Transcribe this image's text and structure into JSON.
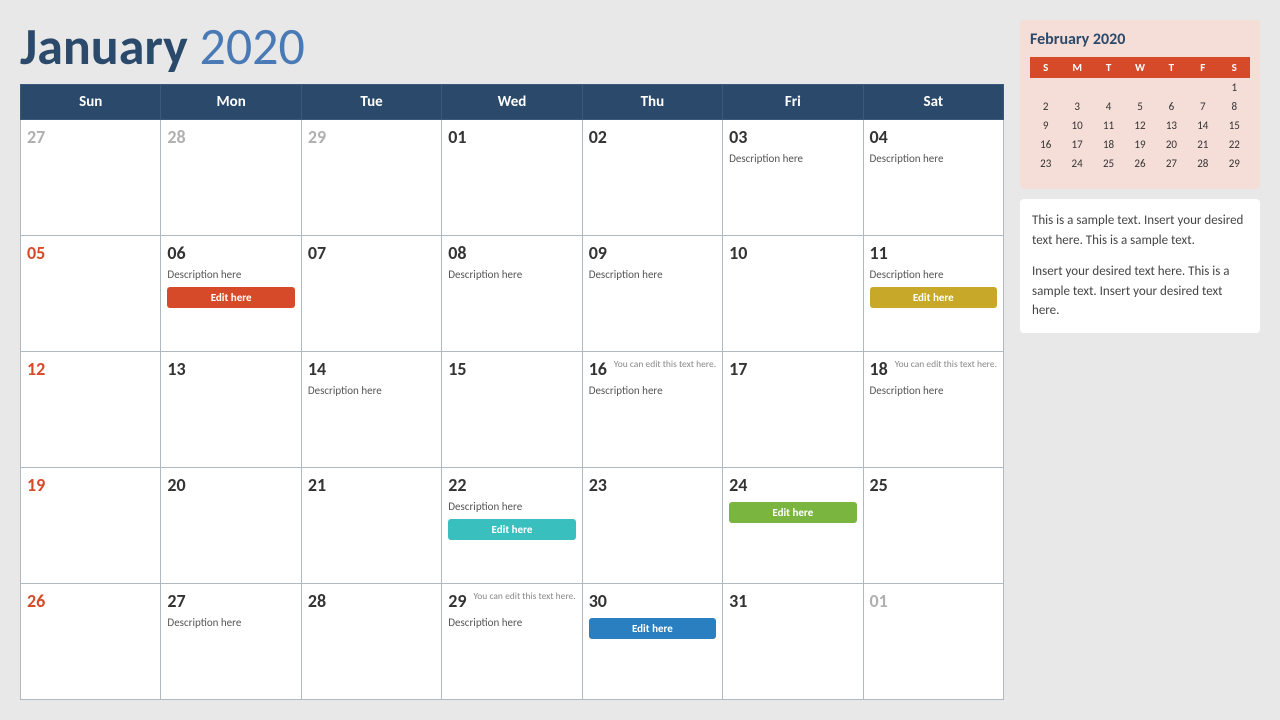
{
  "header": {
    "title_bold": "January",
    "title_light": " 2020"
  },
  "weekdays": [
    "Sun",
    "Mon",
    "Tue",
    "Wed",
    "Thu",
    "Fri",
    "Sat"
  ],
  "weeks": [
    [
      {
        "day": "27",
        "type": "grayed"
      },
      {
        "day": "28",
        "type": "grayed"
      },
      {
        "day": "29",
        "type": "grayed"
      },
      {
        "day": "01",
        "desc": ""
      },
      {
        "day": "02",
        "desc": ""
      },
      {
        "day": "03",
        "desc": "Description here"
      },
      {
        "day": "04",
        "desc": "Description here"
      }
    ],
    [
      {
        "day": "05",
        "type": "sunday"
      },
      {
        "day": "06",
        "desc": "Description here",
        "btn": "Edit here",
        "btnClass": "btn-orange"
      },
      {
        "day": "07",
        "desc": ""
      },
      {
        "day": "08",
        "desc": "Description here"
      },
      {
        "day": "09",
        "desc": "Description here"
      },
      {
        "day": "10",
        "desc": ""
      },
      {
        "day": "11",
        "desc": "Description here",
        "btn": "Edit here",
        "btnClass": "btn-yellow"
      }
    ],
    [
      {
        "day": "12",
        "type": "sunday"
      },
      {
        "day": "13",
        "desc": ""
      },
      {
        "day": "14",
        "desc": "Description here"
      },
      {
        "day": "15",
        "desc": ""
      },
      {
        "day": "16",
        "desc": "Description here",
        "note": "You can edit this text here."
      },
      {
        "day": "17",
        "desc": ""
      },
      {
        "day": "18",
        "desc": "Description here",
        "note": "You can edit this text here."
      }
    ],
    [
      {
        "day": "19",
        "type": "sunday"
      },
      {
        "day": "20",
        "desc": ""
      },
      {
        "day": "21",
        "desc": ""
      },
      {
        "day": "22",
        "desc": "Description here",
        "btn": "Edit here",
        "btnClass": "btn-teal"
      },
      {
        "day": "23",
        "desc": ""
      },
      {
        "day": "24",
        "desc": "",
        "btn": "Edit here",
        "btnClass": "btn-green"
      },
      {
        "day": "25",
        "desc": ""
      }
    ],
    [
      {
        "day": "26",
        "type": "sunday"
      },
      {
        "day": "27",
        "desc": "Description here"
      },
      {
        "day": "28",
        "desc": ""
      },
      {
        "day": "29",
        "desc": "Description here",
        "note": "You can edit this text here."
      },
      {
        "day": "30",
        "desc": "",
        "btn": "Edit here",
        "btnClass": "btn-blue"
      },
      {
        "day": "31",
        "desc": ""
      },
      {
        "day": "01",
        "type": "grayed"
      }
    ]
  ],
  "sidebar": {
    "mini_title": "February 2020",
    "mini_weekdays": [
      "S",
      "M",
      "T",
      "W",
      "T",
      "F",
      "S"
    ],
    "mini_weeks": [
      [
        {
          "d": "",
          "g": true
        },
        {
          "d": "",
          "g": true
        },
        {
          "d": "",
          "g": true
        },
        {
          "d": "",
          "g": true
        },
        {
          "d": "",
          "g": true
        },
        {
          "d": "",
          "g": true
        },
        {
          "d": "1",
          "g": false
        }
      ],
      [
        {
          "d": "2",
          "g": false
        },
        {
          "d": "3",
          "g": false
        },
        {
          "d": "4",
          "g": false
        },
        {
          "d": "5",
          "g": false
        },
        {
          "d": "6",
          "g": false
        },
        {
          "d": "7",
          "g": false
        },
        {
          "d": "8",
          "g": false
        }
      ],
      [
        {
          "d": "9",
          "g": false
        },
        {
          "d": "10",
          "g": false
        },
        {
          "d": "11",
          "g": false
        },
        {
          "d": "12",
          "g": false
        },
        {
          "d": "13",
          "g": false
        },
        {
          "d": "14",
          "g": false
        },
        {
          "d": "15",
          "g": false
        }
      ],
      [
        {
          "d": "16",
          "g": false
        },
        {
          "d": "17",
          "g": false
        },
        {
          "d": "18",
          "g": false
        },
        {
          "d": "19",
          "g": false
        },
        {
          "d": "20",
          "g": false
        },
        {
          "d": "21",
          "g": false
        },
        {
          "d": "22",
          "g": false
        }
      ],
      [
        {
          "d": "23",
          "g": false
        },
        {
          "d": "24",
          "g": false
        },
        {
          "d": "25",
          "g": false
        },
        {
          "d": "26",
          "g": false
        },
        {
          "d": "27",
          "g": false
        },
        {
          "d": "28",
          "g": false
        },
        {
          "d": "29",
          "g": false
        }
      ],
      [
        {
          "d": "",
          "g": true
        },
        {
          "d": "",
          "g": true
        },
        {
          "d": "",
          "g": true
        },
        {
          "d": "",
          "g": true
        },
        {
          "d": "",
          "g": true
        },
        {
          "d": "",
          "g": true
        },
        {
          "d": "",
          "g": true
        }
      ]
    ],
    "text1": "This is a sample text. Insert your desired text here. This is a sample text.",
    "text2": "Insert your desired text here. This is a sample text. Insert your desired text here."
  }
}
